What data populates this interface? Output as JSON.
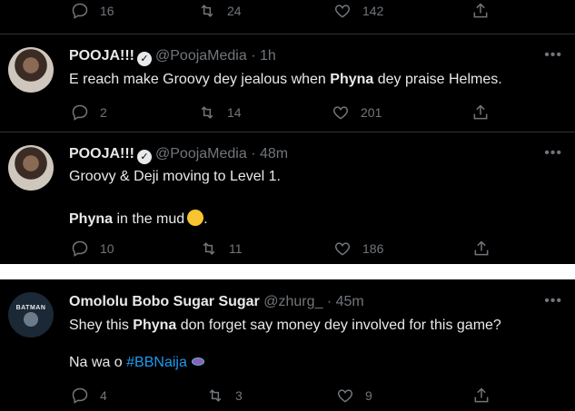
{
  "tweets": [
    {
      "name": "",
      "handle": "",
      "time": "",
      "text_lines": [],
      "actions": {
        "replies": "16",
        "retweets": "24",
        "likes": "142"
      }
    },
    {
      "name": "POOJA!!!",
      "handle": "@PoojaMedia",
      "time": "· 1h",
      "text_pre": "E reach make Groovy dey jealous when ",
      "text_bold": "Phyna",
      "text_post": " dey praise Helmes.",
      "actions": {
        "replies": "2",
        "retweets": "14",
        "likes": "201"
      }
    },
    {
      "name": "POOJA!!!",
      "handle": "@PoojaMedia",
      "time": "· 48m",
      "line1": "Groovy & Deji moving to Level 1.",
      "line2_bold": "Phyna",
      "line2_post": " in the mud",
      "line2_end": ".",
      "actions": {
        "replies": "10",
        "retweets": "11",
        "likes": "186"
      }
    },
    {
      "name": "Omololu Bobo Sugar Sugar",
      "handle": "@zhurg_",
      "time": "· 45m",
      "avatar_text": "BATMAN",
      "line1_pre": "Shey this ",
      "line1_bold": "Phyna",
      "line1_post": " don forget say money dey involved for this game?",
      "line2_pre": "Na wa o ",
      "hashtag": "#BBNaija",
      "actions": {
        "replies": "4",
        "retweets": "3",
        "likes": "9"
      }
    }
  ],
  "icons": {
    "reply": "reply-icon",
    "retweet": "retweet-icon",
    "like": "like-icon",
    "share": "share-icon",
    "more": "more-icon",
    "verified": "verified-icon"
  },
  "colors": {
    "background": "#000000",
    "text": "#e7e9ea",
    "muted": "#71767b",
    "link": "#1d9bf0",
    "divider": "#2f3336"
  }
}
